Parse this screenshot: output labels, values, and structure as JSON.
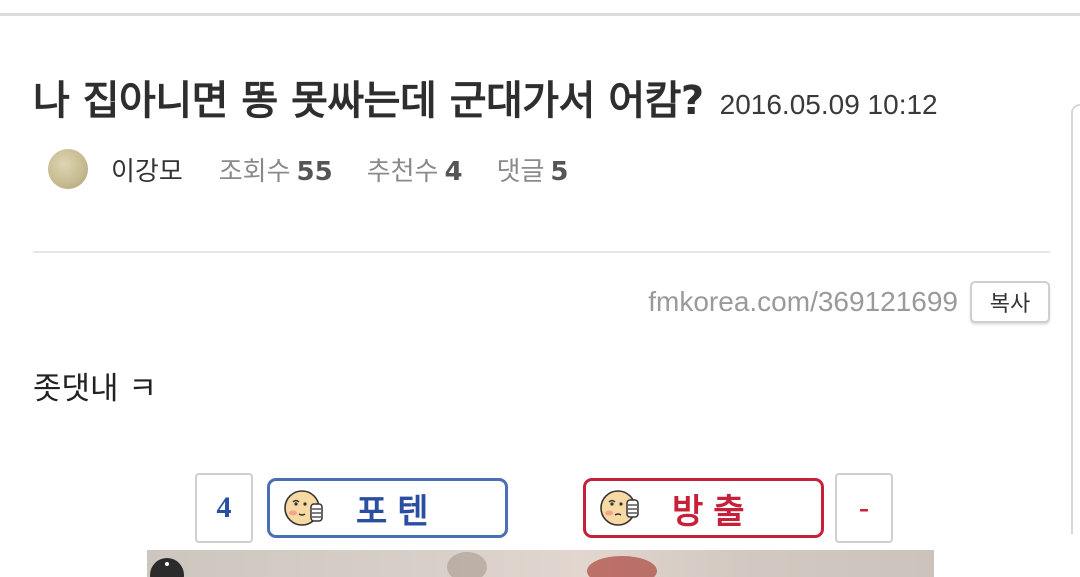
{
  "post": {
    "title": "나 집아니면 똥 못싸는데 군대가서 어캄?",
    "date": "2016.05.09 10:12",
    "author": "이강모",
    "views_label": "조회수",
    "views": "55",
    "recommend_label": "추천수",
    "recommend": "4",
    "comments_label": "댓글",
    "comments": "5",
    "url": "fmkorea.com/369121699",
    "copy_label": "복사",
    "content": "좃댓내 ㅋ"
  },
  "votes": {
    "up_count": "4",
    "up_label": "포텐",
    "down_label": "방출",
    "down_count": "-"
  },
  "colors": {
    "up": "#2a4ea0",
    "down": "#c7203a"
  }
}
